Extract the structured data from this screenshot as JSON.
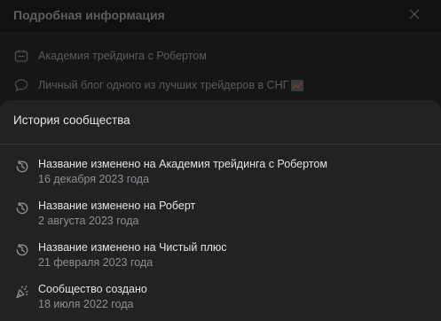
{
  "background_dialog": {
    "title": "Подробная информация",
    "rows": [
      {
        "icon": "calendar-icon",
        "text": "Академия трейдинга с Робертом"
      },
      {
        "icon": "chat-bubble-icon",
        "text": "Личный блог одного из лучших трейдеров в СНГ"
      }
    ]
  },
  "history": {
    "title": "История сообщества",
    "items": [
      {
        "icon": "history-icon",
        "title": "Название изменено на Академия трейдинга с Робертом",
        "date": "16 декабря 2023 года"
      },
      {
        "icon": "history-icon",
        "title": "Название изменено на Роберт",
        "date": "2 августа 2023 года"
      },
      {
        "icon": "history-icon",
        "title": "Название изменено на Чистый плюс",
        "date": "21 февраля 2023 года"
      },
      {
        "icon": "party-popper-icon",
        "title": "Сообщество создано",
        "date": "18 июля 2022 года"
      }
    ]
  }
}
